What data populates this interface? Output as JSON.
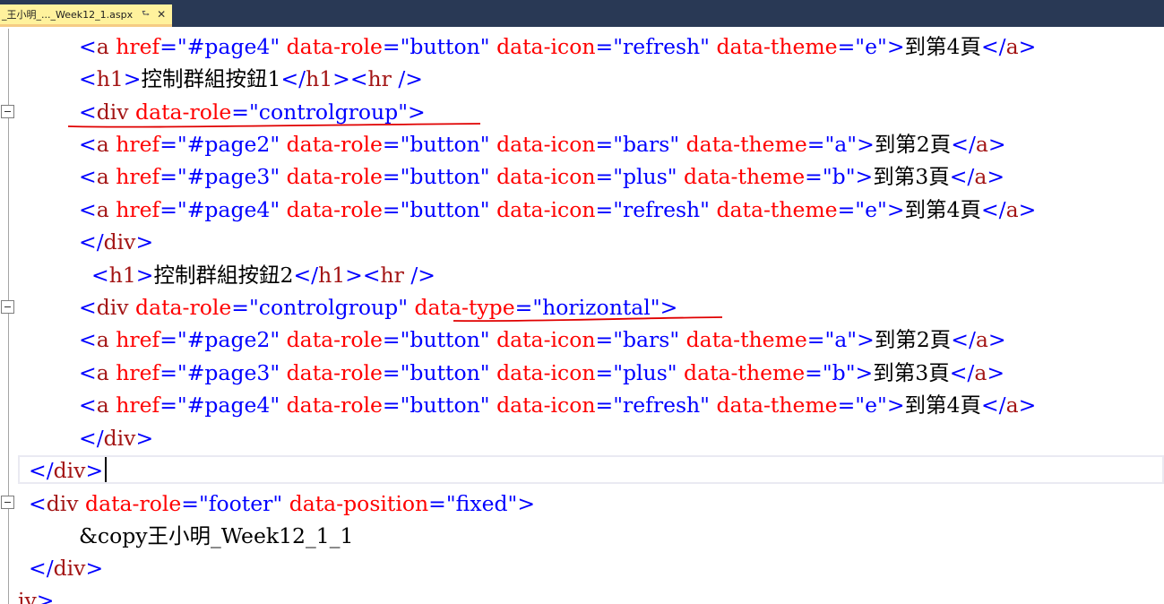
{
  "tab": {
    "title": "_王小明_..._Week12_1.aspx",
    "pin_icon": "pin-icon",
    "close_icon": "close-icon"
  },
  "code": {
    "lines": [
      {
        "id": "l0",
        "tokens": [
          "<",
          "a",
          " ",
          "href",
          "=",
          "\"#page4\"",
          " ",
          "data-role",
          "=",
          "\"button\"",
          " ",
          "data-icon",
          "=",
          "\"refresh\"",
          " ",
          "data-theme",
          "=",
          "\"e\"",
          ">",
          "到第4頁",
          "</",
          "a",
          ">"
        ]
      },
      {
        "id": "l1",
        "tokens": [
          "<",
          "h1",
          ">",
          "控制群組按鈕1",
          "</",
          "h1",
          "><",
          "hr",
          " />"
        ]
      },
      {
        "id": "l2",
        "tokens": [
          "<",
          "div",
          " ",
          "data-role",
          "=",
          "\"controlgroup\"",
          ">"
        ]
      },
      {
        "id": "l3",
        "tokens": [
          "<",
          "a",
          " ",
          "href",
          "=",
          "\"#page2\"",
          " ",
          "data-role",
          "=",
          "\"button\"",
          " ",
          "data-icon",
          "=",
          "\"bars\"",
          " ",
          "data-theme",
          "=",
          "\"a\"",
          ">",
          "到第2頁",
          "</",
          "a",
          ">"
        ]
      },
      {
        "id": "l4",
        "tokens": [
          "<",
          "a",
          " ",
          "href",
          "=",
          "\"#page3\"",
          " ",
          "data-role",
          "=",
          "\"button\"",
          " ",
          "data-icon",
          "=",
          "\"plus\"",
          " ",
          "data-theme",
          "=",
          "\"b\"",
          ">",
          "到第3頁",
          "</",
          "a",
          ">"
        ]
      },
      {
        "id": "l5",
        "tokens": [
          "<",
          "a",
          " ",
          "href",
          "=",
          "\"#page4\"",
          " ",
          "data-role",
          "=",
          "\"button\"",
          " ",
          "data-icon",
          "=",
          "\"refresh\"",
          " ",
          "data-theme",
          "=",
          "\"e\"",
          ">",
          "到第4頁",
          "</",
          "a",
          ">"
        ]
      },
      {
        "id": "l6",
        "tokens": [
          "</",
          "div",
          ">"
        ]
      },
      {
        "id": "l7",
        "tokens": [
          "<",
          "h1",
          ">",
          "控制群組按鈕2",
          "</",
          "h1",
          "><",
          "hr",
          " />"
        ]
      },
      {
        "id": "l8",
        "tokens": [
          "<",
          "div",
          " ",
          "data-role",
          "=",
          "\"controlgroup\"",
          " ",
          "data-type",
          "=",
          "\"horizontal\"",
          ">"
        ]
      },
      {
        "id": "l9",
        "tokens": [
          "<",
          "a",
          " ",
          "href",
          "=",
          "\"#page2\"",
          " ",
          "data-role",
          "=",
          "\"button\"",
          " ",
          "data-icon",
          "=",
          "\"bars\"",
          " ",
          "data-theme",
          "=",
          "\"a\"",
          ">",
          "到第2頁",
          "</",
          "a",
          ">"
        ]
      },
      {
        "id": "l10",
        "tokens": [
          "<",
          "a",
          " ",
          "href",
          "=",
          "\"#page3\"",
          " ",
          "data-role",
          "=",
          "\"button\"",
          " ",
          "data-icon",
          "=",
          "\"plus\"",
          " ",
          "data-theme",
          "=",
          "\"b\"",
          ">",
          "到第3頁",
          "</",
          "a",
          ">"
        ]
      },
      {
        "id": "l11",
        "tokens": [
          "<",
          "a",
          " ",
          "href",
          "=",
          "\"#page4\"",
          " ",
          "data-role",
          "=",
          "\"button\"",
          " ",
          "data-icon",
          "=",
          "\"refresh\"",
          " ",
          "data-theme",
          "=",
          "\"e\"",
          ">",
          "到第4頁",
          "</",
          "a",
          ">"
        ]
      },
      {
        "id": "l12",
        "tokens": [
          "</",
          "div",
          ">"
        ]
      },
      {
        "id": "l13",
        "tokens": [
          "</",
          "div",
          ">"
        ]
      },
      {
        "id": "l14",
        "tokens": [
          "<",
          "div",
          " ",
          "data-role",
          "=",
          "\"footer\"",
          " ",
          "data-position",
          "=",
          "\"fixed\"",
          ">"
        ]
      },
      {
        "id": "l15",
        "tokens": [
          "&copy王小明_Week12_1_1"
        ]
      },
      {
        "id": "l16",
        "tokens": [
          "</",
          "div",
          ">"
        ]
      },
      {
        "id": "l17",
        "tokens": [
          "iv>"
        ]
      }
    ]
  },
  "colors": {
    "tag_bracket": "#0000ff",
    "element_name": "#a31515",
    "attribute_name": "#ff0000",
    "attribute_value": "#0000ff",
    "text": "#000000",
    "annotation": "#e00000",
    "tab_active": "#fff29d",
    "title_bar": "#293955"
  }
}
